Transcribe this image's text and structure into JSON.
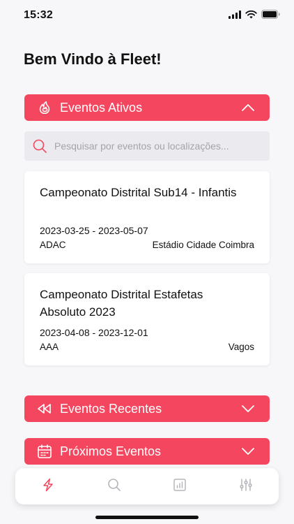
{
  "status_bar": {
    "time": "15:32"
  },
  "welcome_title": "Bem Vindo à Fleet!",
  "sections": {
    "active": {
      "label": "Eventos Ativos",
      "icon": "fire-icon",
      "expanded": true
    },
    "recent": {
      "label": "Eventos Recentes",
      "icon": "rewind-icon",
      "expanded": false
    },
    "upcoming": {
      "label": "Próximos Eventos",
      "icon": "calendar-icon",
      "expanded": false
    }
  },
  "search": {
    "placeholder": "Pesquisar por eventos ou localizações...",
    "value": ""
  },
  "events": [
    {
      "title": "Campeonato Distrital Sub14 - Infantis",
      "dates": "2023-03-25 - 2023-05-07",
      "organizer": "ADAC",
      "location": "Estádio Cidade Coimbra"
    },
    {
      "title": "Campeonato Distrital Estafetas Absoluto 2023",
      "dates": "2023-04-08 - 2023-12-01",
      "organizer": "AAA",
      "location": "Vagos"
    }
  ],
  "tabs": [
    {
      "icon": "lightning-icon",
      "active": true
    },
    {
      "icon": "search-icon",
      "active": false
    },
    {
      "icon": "chart-icon",
      "active": false
    },
    {
      "icon": "sliders-icon",
      "active": false
    }
  ],
  "colors": {
    "accent": "#f4475f",
    "background": "#f7f7f9",
    "inactive_icon": "#b5b5bb"
  }
}
